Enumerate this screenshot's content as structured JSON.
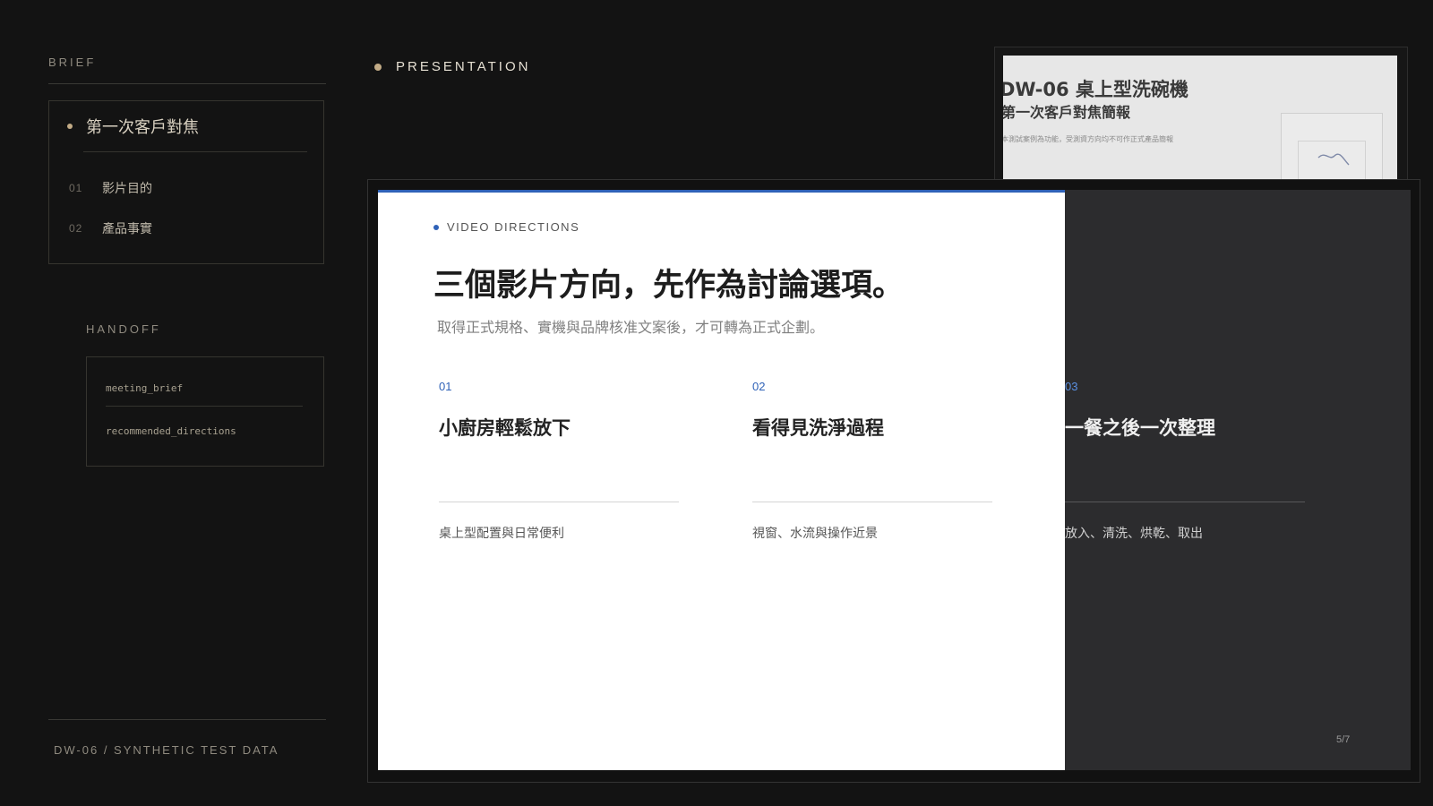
{
  "brief": {
    "label": "BRIEF",
    "outline_title": "第一次客戶對焦",
    "items": [
      {
        "num": "01",
        "label": "影片目的"
      },
      {
        "num": "02",
        "label": "產品事實"
      }
    ]
  },
  "handoff": {
    "label": "HANDOFF",
    "items": [
      "meeting_brief",
      "recommended_directions"
    ]
  },
  "footer": {
    "label": "DW-06 / SYNTHETIC TEST DATA"
  },
  "presentation": {
    "label": "PRESENTATION"
  },
  "back_slide": {
    "title": "DW-06 桌上型洗碗機",
    "subtitle": "第一次客戶對焦簡報",
    "note": "本測試案例為功能，受測資方向均不可作正式產品簡報"
  },
  "slide": {
    "eyebrow": "VIDEO DIRECTIONS",
    "title": "三個影片方向，先作為討論選項。",
    "subtitle": "取得正式規格、實機與品牌核准文案後，才可轉為正式企劃。",
    "columns": [
      {
        "num": "01",
        "title": "小廚房輕鬆放下",
        "desc": "桌上型配置與日常便利"
      },
      {
        "num": "02",
        "title": "看得見洗淨過程",
        "desc": "視窗、水流與操作近景"
      },
      {
        "num": "03",
        "title": "一餐之後一次整理",
        "desc": "放入、清洗、烘乾、取出"
      }
    ],
    "page": "5/7"
  },
  "colors": {
    "background": "#131313",
    "accent_gold": "#c2ab86",
    "accent_blue": "#2f62b8"
  }
}
